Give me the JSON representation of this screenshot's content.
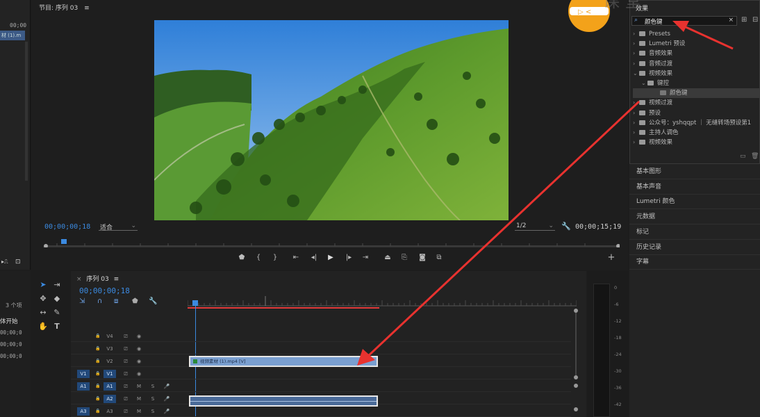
{
  "project_panel": {
    "timecode_fragment": "00;00",
    "clip_fragment": "材 (1).m",
    "item_count": "3 个项",
    "col_header": "体开始",
    "rows": [
      "00;00;0",
      "00;00;0",
      "00;00;0"
    ]
  },
  "program_monitor": {
    "tab_title": "节目: 序列 03",
    "menu_icon": "≡",
    "current_timecode": "00;00;00;18",
    "fit_label": "适合",
    "resolution_label": "1/2",
    "duration_timecode": "00;00;15;19",
    "plus_label": "+"
  },
  "effects_panel": {
    "title": "效果",
    "search_value": "颜色键",
    "tree": [
      {
        "label": "Presets",
        "indent": 0,
        "expanded": false,
        "kind": "folder"
      },
      {
        "label": "Lumetri 预设",
        "indent": 0,
        "expanded": false,
        "kind": "folder"
      },
      {
        "label": "音频效果",
        "indent": 0,
        "expanded": false,
        "kind": "folder"
      },
      {
        "label": "音频过渡",
        "indent": 0,
        "expanded": false,
        "kind": "folder"
      },
      {
        "label": "视频效果",
        "indent": 0,
        "expanded": true,
        "kind": "folder"
      },
      {
        "label": "键控",
        "indent": 1,
        "expanded": true,
        "kind": "folder"
      },
      {
        "label": "颜色键",
        "indent": 2,
        "expanded": false,
        "kind": "effect",
        "selected": true
      },
      {
        "label": "视频过渡",
        "indent": 0,
        "expanded": false,
        "kind": "folder"
      },
      {
        "label": "预设",
        "indent": 0,
        "expanded": false,
        "kind": "folder"
      },
      {
        "label": "公众号：yshqqpt ｜ 无缝转场预设第1",
        "indent": 0,
        "expanded": false,
        "kind": "folder"
      },
      {
        "label": "主持人调色",
        "indent": 0,
        "expanded": false,
        "kind": "folder"
      },
      {
        "label": "视频效果",
        "indent": 0,
        "expanded": false,
        "kind": "folder"
      }
    ]
  },
  "side_panels": [
    "基本图形",
    "基本声音",
    "Lumetri 颜色",
    "元数据",
    "标记",
    "历史记录",
    "字幕"
  ],
  "timeline": {
    "close_icon": "×",
    "title": "序列 03",
    "menu_icon": "≡",
    "timecode": "00;00;00;18",
    "tracks": [
      {
        "name": "V4",
        "src": "",
        "type": "video"
      },
      {
        "name": "V3",
        "src": "",
        "type": "video"
      },
      {
        "name": "V2",
        "src": "",
        "type": "video"
      },
      {
        "name": "V1",
        "src": "V1",
        "type": "video"
      },
      {
        "name": "A1",
        "src": "A1",
        "type": "audio"
      },
      {
        "name": "A2",
        "src": "",
        "type": "audio"
      },
      {
        "name": "A3",
        "src": "A3",
        "type": "audio"
      }
    ],
    "clip_v2_label": "视频素材 (1).mp4 [V]"
  },
  "audio_meter": {
    "scale": [
      "0",
      "-6",
      "-12",
      "-18",
      "-24",
      "-30",
      "-36",
      "-42"
    ]
  },
  "colors": {
    "accent_blue": "#3b8ae0",
    "annotation_red": "#e8322f",
    "clip_blue": "#7a9fd0"
  }
}
